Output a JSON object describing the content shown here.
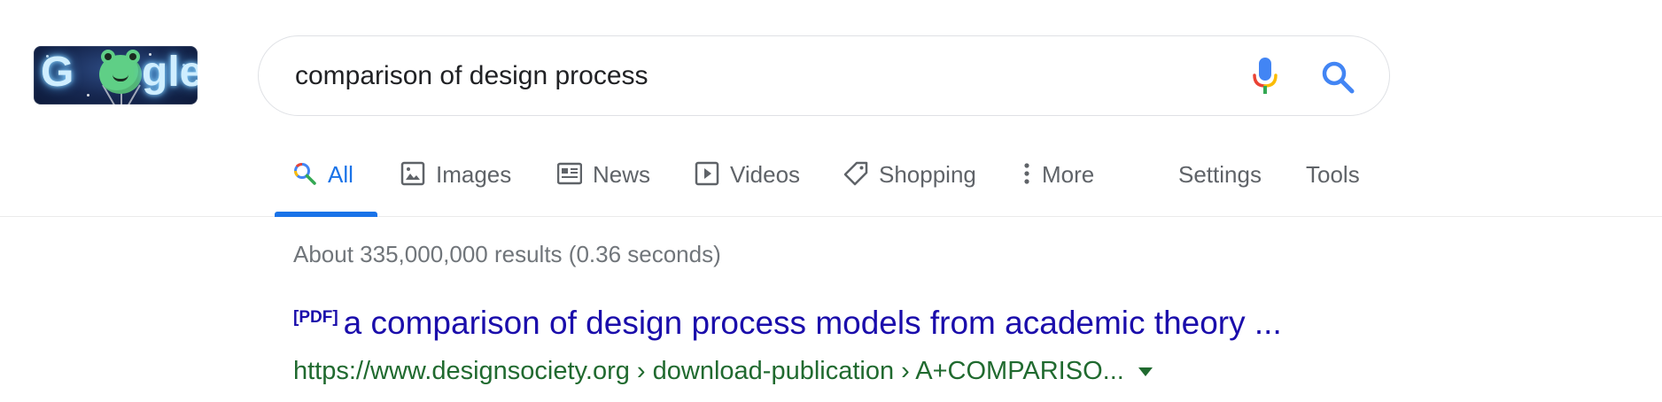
{
  "logo": {
    "letters": [
      "G",
      "gle"
    ],
    "icon": "google-doodle-frog-logo"
  },
  "search": {
    "query": "comparison of design process",
    "mic_icon": "microphone-icon",
    "search_icon": "search-icon"
  },
  "tabs": [
    {
      "label": "All",
      "icon": "search-icon",
      "active": true
    },
    {
      "label": "Images",
      "icon": "image-icon",
      "active": false
    },
    {
      "label": "News",
      "icon": "news-icon",
      "active": false
    },
    {
      "label": "Videos",
      "icon": "play-icon",
      "active": false
    },
    {
      "label": "Shopping",
      "icon": "tag-icon",
      "active": false
    },
    {
      "label": "More",
      "icon": "more-vert-icon",
      "active": false
    }
  ],
  "tools": {
    "settings": "Settings",
    "tools": "Tools"
  },
  "results": {
    "stats": "About 335,000,000 results (0.36 seconds)",
    "items": [
      {
        "badge": "[PDF]",
        "title": "a comparison of design process models from academic theory ...",
        "url": "https://www.designsociety.org › download-publication › A+COMPARISO..."
      }
    ]
  },
  "colors": {
    "link": "#1a0dab",
    "url": "#206a2f",
    "active_tab": "#1a73e8",
    "muted": "#70757a"
  }
}
